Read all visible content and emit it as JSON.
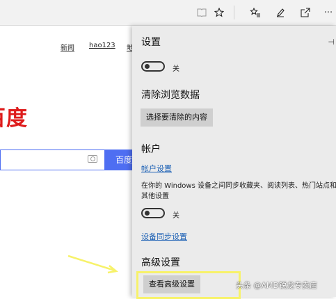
{
  "toolbar": {
    "icons": [
      "reading-view-icon",
      "favorite-star-icon",
      "favorites-hub-icon",
      "web-note-icon",
      "share-icon",
      "more-icon"
    ],
    "more_glyph": "···"
  },
  "page": {
    "nav_links": [
      "新闻",
      "hao123",
      "地"
    ],
    "logo": "百度",
    "search_button": "百度"
  },
  "settings": {
    "title": "设置",
    "toggle1_label": "关",
    "clear_title": "清除浏览数据",
    "clear_button": "选择要清除的内容",
    "account_title": "帐户",
    "account_link": "帐户设置",
    "sync_text": "在你的 Windows 设备之间同步收藏夹、阅读列表、热门站点和其他设置",
    "toggle2_label": "关",
    "sync_link": "设备同步设置",
    "advanced_title": "高级设置",
    "advanced_button": "查看高级设置"
  },
  "watermark": "头条 @AMD锐龙专卖店",
  "colors": {
    "highlight": "#f7f26a",
    "link": "#1a5fb4",
    "baidu_red": "#de1b1b",
    "baidu_blue": "#4e6ef2"
  }
}
